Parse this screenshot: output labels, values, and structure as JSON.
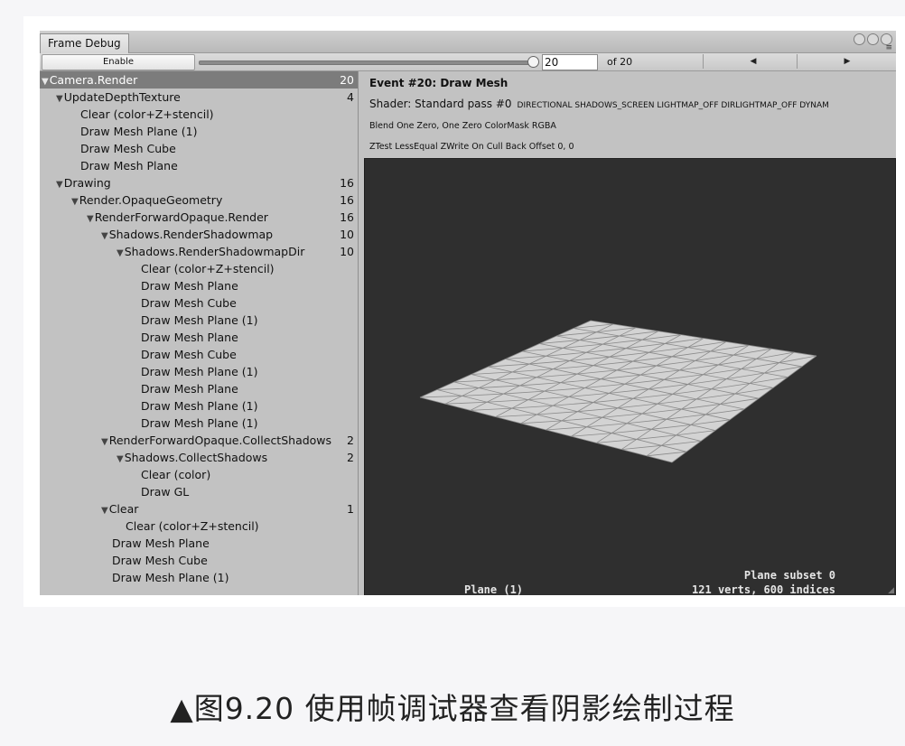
{
  "window": {
    "tab_label": "Frame Debug",
    "menu_icon": "≡"
  },
  "toolbar": {
    "enable_label": "Enable",
    "frame_value": "20",
    "of_label": "of 20",
    "prev_label": "◀",
    "next_label": "▶",
    "progress": 1.0
  },
  "tree": [
    {
      "label": "Camera.Render",
      "count": "20",
      "arrow": true,
      "selected": true
    },
    {
      "label": "UpdateDepthTexture",
      "count": "4",
      "arrow": true
    },
    {
      "label": "Clear (color+Z+stencil)",
      "count": ""
    },
    {
      "label": "Draw Mesh Plane (1)",
      "count": ""
    },
    {
      "label": "Draw Mesh Cube",
      "count": ""
    },
    {
      "label": "Draw Mesh Plane",
      "count": ""
    },
    {
      "label": "Drawing",
      "count": "16",
      "arrow": true
    },
    {
      "label": "Render.OpaqueGeometry",
      "count": "16",
      "arrow": true
    },
    {
      "label": "RenderForwardOpaque.Render",
      "count": "16",
      "arrow": true
    },
    {
      "label": "Shadows.RenderShadowmap",
      "count": "10",
      "arrow": true
    },
    {
      "label": "Shadows.RenderShadowmapDir",
      "count": "10",
      "arrow": true
    },
    {
      "label": "Clear (color+Z+stencil)",
      "count": ""
    },
    {
      "label": "Draw Mesh Plane",
      "count": ""
    },
    {
      "label": "Draw Mesh Cube",
      "count": ""
    },
    {
      "label": "Draw Mesh Plane (1)",
      "count": ""
    },
    {
      "label": "Draw Mesh Plane",
      "count": ""
    },
    {
      "label": "Draw Mesh Cube",
      "count": ""
    },
    {
      "label": "Draw Mesh Plane (1)",
      "count": ""
    },
    {
      "label": "Draw Mesh Plane",
      "count": ""
    },
    {
      "label": "Draw Mesh Plane (1)",
      "count": ""
    },
    {
      "label": "Draw Mesh Plane (1)",
      "count": ""
    },
    {
      "label": "RenderForwardOpaque.CollectShadows",
      "count": "2",
      "arrow": true
    },
    {
      "label": "Shadows.CollectShadows",
      "count": "2",
      "arrow": true
    },
    {
      "label": "Clear (color)",
      "count": ""
    },
    {
      "label": "Draw GL",
      "count": ""
    },
    {
      "label": "Clear",
      "count": "1",
      "arrow": true
    },
    {
      "label": "Clear (color+Z+stencil)",
      "count": ""
    },
    {
      "label": "Draw Mesh Plane",
      "count": ""
    },
    {
      "label": "Draw Mesh Cube",
      "count": ""
    },
    {
      "label": "Draw Mesh Plane (1)",
      "count": ""
    }
  ],
  "details": {
    "event_title": "Event #20: Draw Mesh",
    "shader_text": "Shader: Standard pass #0",
    "shader_keywords": "DIRECTIONAL SHADOWS_SCREEN LIGHTMAP_OFF DIRLIGHTMAP_OFF DYNAM",
    "blend_text": "Blend One Zero, One Zero ColorMask RGBA",
    "ztest_text": "ZTest LessEqual ZWrite On Cull Back Offset 0, 0",
    "mesh_name": "Plane (1)",
    "subset_text": "Plane subset 0",
    "stats_text": "121 verts, 600 indices"
  },
  "caption": "▲图9.20 使用帧调试器查看阴影绘制过程",
  "colors": {
    "selected_row": "#7c7c7c",
    "panel_bg": "#c2c2c2",
    "preview_bg": "#2f2f2f",
    "mesh_fill": "#d3d3d3"
  }
}
